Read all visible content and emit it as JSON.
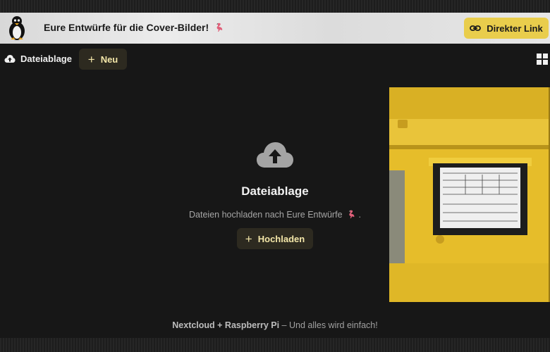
{
  "header": {
    "title": "Eure Entwürfe für die Cover-Bilder!",
    "direct_link_label": "Direkter Link"
  },
  "toolbar": {
    "breadcrumb_label": "Dateiablage",
    "new_label": "Neu"
  },
  "empty_state": {
    "title": "Dateiablage",
    "description": "Dateien hochladen nach Eure Entwürfe",
    "description_suffix": ".",
    "upload_label": "Hochladen"
  },
  "footer": {
    "brand": "Nextcloud + Raspberry Pi",
    "tagline": "– Und alles wird einfach!"
  },
  "colors": {
    "accent": "#e9cd4c",
    "background": "#171717",
    "button_dark": "#2d2a20"
  }
}
